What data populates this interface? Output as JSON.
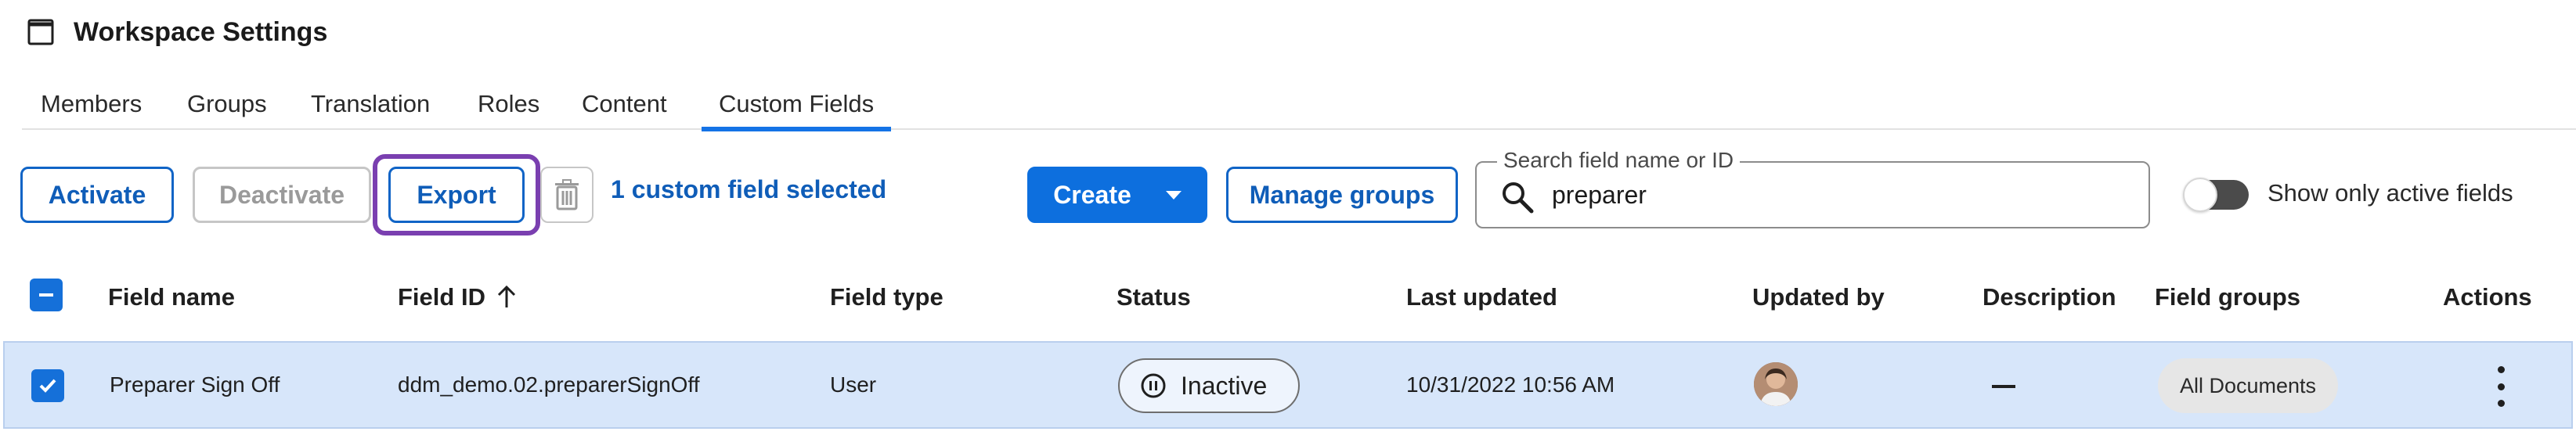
{
  "header": {
    "title": "Workspace Settings",
    "icon": "window-icon"
  },
  "tabs": [
    {
      "label": "Members"
    },
    {
      "label": "Groups"
    },
    {
      "label": "Translation"
    },
    {
      "label": "Roles"
    },
    {
      "label": "Content"
    },
    {
      "label": "Custom Fields",
      "active": true
    }
  ],
  "toolbar": {
    "activate_label": "Activate",
    "deactivate_label": "Deactivate",
    "export_label": "Export",
    "selection_text": "1 custom field selected",
    "create_label": "Create",
    "manage_groups_label": "Manage groups",
    "search": {
      "legend": "Search field name or ID",
      "value": "preparer"
    },
    "toggle_label": "Show only active fields",
    "toggle_on": false
  },
  "table": {
    "columns": [
      "Field name",
      "Field ID",
      "Field type",
      "Status",
      "Last updated",
      "Updated by",
      "Description",
      "Field groups",
      "Actions"
    ],
    "sort_column": "Field ID",
    "sort_direction": "ascending",
    "rows": [
      {
        "selected": true,
        "field_name": "Preparer Sign Off",
        "field_id": "ddm_demo.02.preparerSignOff",
        "field_type": "User",
        "status": "Inactive",
        "last_updated": "10/31/2022 10:56 AM",
        "updated_by": "avatar",
        "description": "—",
        "field_groups": "All Documents"
      }
    ]
  },
  "colors": {
    "accent": "#0d6fde",
    "link": "#0f5db8",
    "focus_ring": "#7a3fb0",
    "selected_row": "#d7e6fa"
  }
}
